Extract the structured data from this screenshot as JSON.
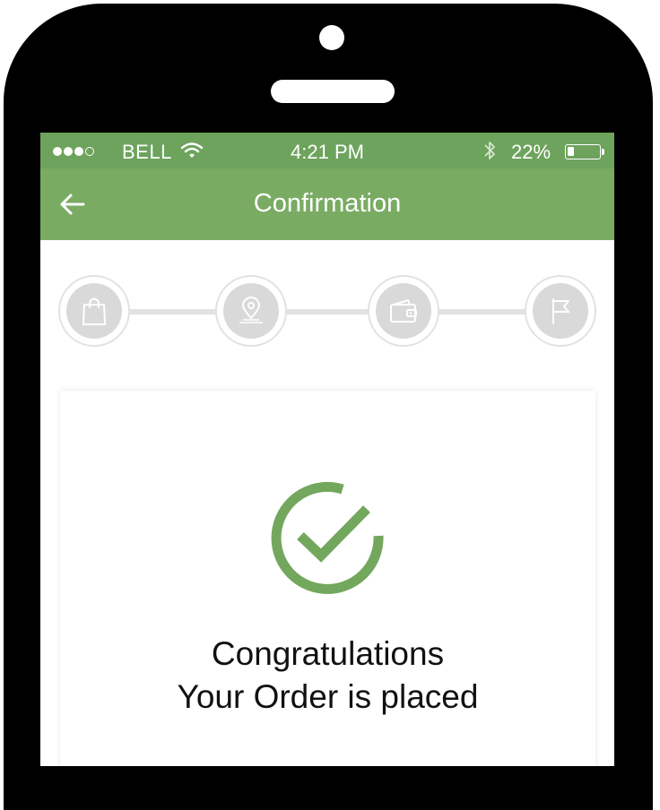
{
  "status_bar": {
    "signal_dots": "●●●○",
    "carrier": "BELL",
    "time": "4:21 PM",
    "battery_percent": "22%",
    "battery_level": 0.22,
    "icons": [
      "wifi-icon",
      "bluetooth-icon",
      "battery-icon"
    ]
  },
  "header": {
    "back_icon": "arrow-left-icon",
    "title": "Confirmation"
  },
  "stepper": {
    "steps": [
      {
        "icon": "shopping-bag-icon"
      },
      {
        "icon": "location-pin-icon"
      },
      {
        "icon": "wallet-icon"
      },
      {
        "icon": "flag-icon"
      }
    ]
  },
  "confirmation": {
    "icon": "check-circle-icon",
    "line1": "Congratulations",
    "line2": "Your Order is placed"
  },
  "colors": {
    "status_bar": "#6da35d",
    "header": "#7aab63",
    "accent": "#73a75e",
    "step_inactive": "#d9d9d9"
  }
}
